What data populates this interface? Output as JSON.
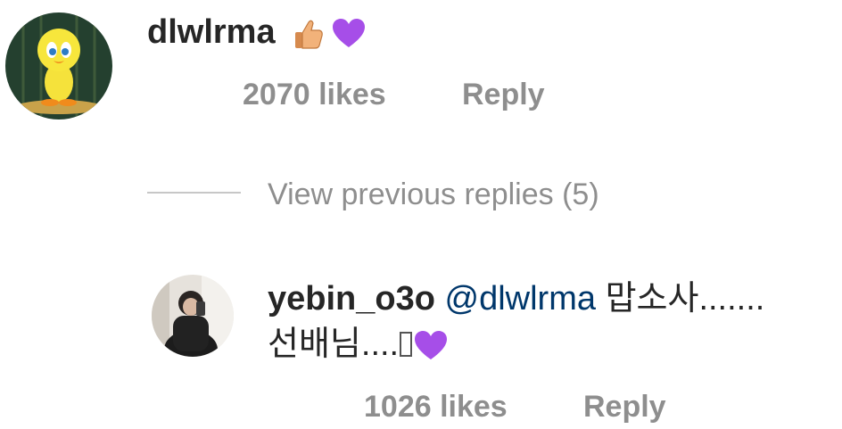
{
  "comments": [
    {
      "username": "dlwlrma",
      "emojis": [
        "thumbs-up-icon",
        "purple-heart-icon"
      ],
      "likes": "2070 likes",
      "reply_label": "Reply"
    },
    {
      "username": "yebin_o3o",
      "mention": "@dlwlrma",
      "text_line1": "맙소사.......",
      "text_line2": "선배님....",
      "emojis": [
        "missing-glyph",
        "purple-heart-icon"
      ],
      "likes": "1026 likes",
      "reply_label": "Reply"
    }
  ],
  "view_previous_label": "View previous replies (5)",
  "colors": {
    "username": "#262626",
    "meta": "#8e8e8e",
    "mention": "#00376b",
    "heart": "#a64ee8"
  }
}
